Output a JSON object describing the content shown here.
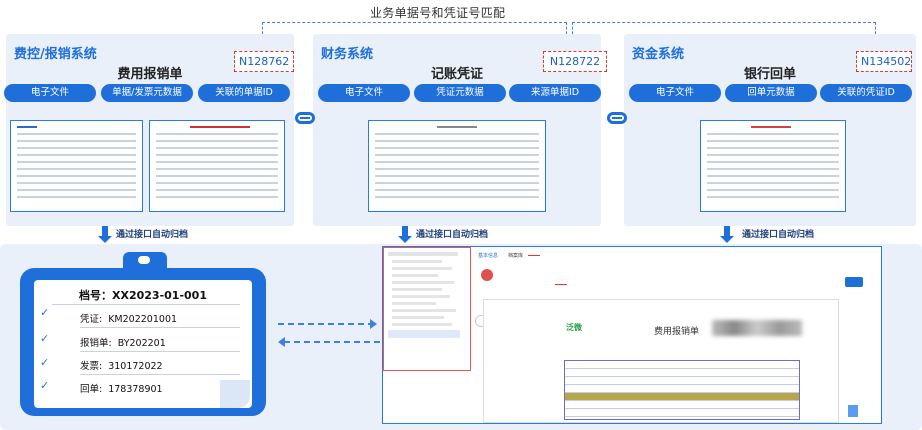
{
  "top_label": "业务单据号和凭证号匹配",
  "systems": [
    {
      "name": "费控/报销系统",
      "doc_title": "费用报销单",
      "doc_no": "N128762",
      "pills": [
        "电子文件",
        "单据/发票元数据",
        "关联的单据ID"
      ]
    },
    {
      "name": "财务系统",
      "doc_title": "记账凭证",
      "doc_no": "N128722",
      "pills": [
        "电子文件",
        "凭证元数据",
        "来源单据ID"
      ]
    },
    {
      "name": "资金系统",
      "doc_title": "银行回单",
      "doc_no": "N134502",
      "pills": [
        "电子文件",
        "回单元数据",
        "关联的凭证ID"
      ]
    }
  ],
  "archive_label": "通过接口自动归档",
  "record": {
    "title": "档号：XX2023-01-001",
    "rows": [
      {
        "label": "凭证:",
        "value": "KM202201001"
      },
      {
        "label": "报销单:",
        "value": "BY202201"
      },
      {
        "label": "发票:",
        "value": "310172022"
      },
      {
        "label": "回单:",
        "value": "178378901"
      }
    ]
  },
  "screenshot": {
    "tab_active": "基本信息",
    "tab_other": "档案库",
    "page_title": "费用报销单",
    "logo_text": "泛微"
  },
  "colors": {
    "accent": "#1f6fdb",
    "panel": "#e9f0fa",
    "dash_red": "#d23a3a"
  }
}
